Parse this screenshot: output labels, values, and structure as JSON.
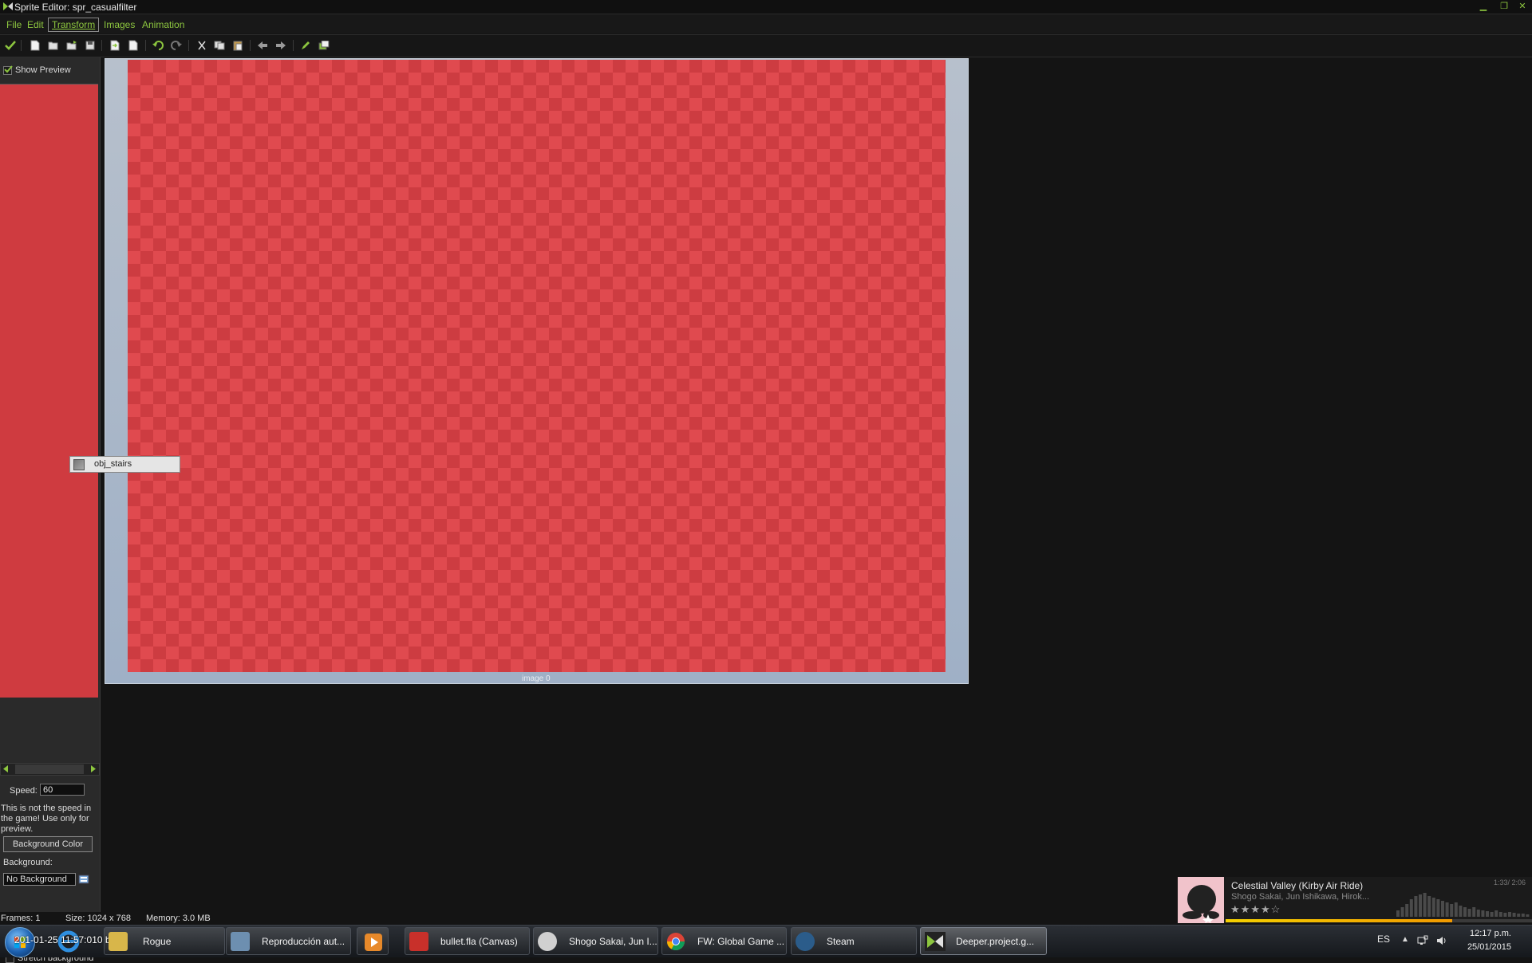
{
  "window": {
    "title": "Sprite Editor: spr_casualfilter",
    "controls": [
      "minimize",
      "maximize",
      "close"
    ]
  },
  "menu": [
    {
      "label": "File"
    },
    {
      "label": "Edit"
    },
    {
      "label": "Transform",
      "active": true
    },
    {
      "label": "Images"
    },
    {
      "label": "Animation"
    }
  ],
  "toolbar": {
    "icons": [
      "confirm-icon",
      "new-icon",
      "open-icon",
      "load-strip-icon",
      "save-icon",
      "import-icon",
      "export-icon",
      "undo-icon",
      "redo-icon",
      "cut-icon",
      "copy-icon",
      "paste-icon",
      "previous-frame-icon",
      "next-frame-icon",
      "edit-pencil-icon",
      "grid-icon"
    ]
  },
  "left_panel": {
    "show_preview_label": "Show Preview",
    "show_preview_checked": true,
    "speed_label": "Speed:",
    "speed_value": "60",
    "speed_note": "This is not the speed in the game! Use only for preview.",
    "background_color_button": "Background Color",
    "background_label": "Background:",
    "background_value": "No Background",
    "stretch_label": "Stretch background",
    "stretch_checked": false
  },
  "canvas": {
    "image_label": "image 0",
    "image_color": "#cd3c41"
  },
  "drag_item": {
    "label": "obj_stairs"
  },
  "status": {
    "frames": "Frames: 1",
    "size": "Size: 1024 x 768",
    "memory": "Memory: 3.0 MB"
  },
  "taskbar": {
    "overlay_text": "201-01-25 11:57:010 b",
    "tasks": [
      {
        "label": "Rogue",
        "icon": "folder-icon",
        "color": "#d8b64a"
      },
      {
        "label": "Reproducción aut...",
        "icon": "autoplay-icon",
        "color": "#6d8fb0"
      },
      {
        "label": "bullet.fla (Canvas)",
        "icon": "flash-icon",
        "color": "#c8302a"
      },
      {
        "label": "Shogo Sakai, Jun I...",
        "icon": "music-player-icon",
        "color": "#d0d0d0"
      },
      {
        "label": "FW: Global Game ...",
        "icon": "chrome-icon",
        "color": "#3f8f3f"
      },
      {
        "label": "Steam",
        "icon": "steam-icon",
        "color": "#2b5c8a"
      },
      {
        "label": "Deeper.project.g...",
        "icon": "gamemaker-icon",
        "color": "#3a3a3a",
        "active": true
      }
    ],
    "language": "ES",
    "time": "12:17 p.m.",
    "date": "25/01/2015"
  },
  "music_widget": {
    "song": "Celestial Valley (Kirby Air Ride)",
    "artist": "Shogo Sakai, Jun Ishikawa, Hirok...",
    "rating_stars": 4,
    "rating_max": 5,
    "time": "1:33/ 2:06",
    "progress": 0.74
  }
}
